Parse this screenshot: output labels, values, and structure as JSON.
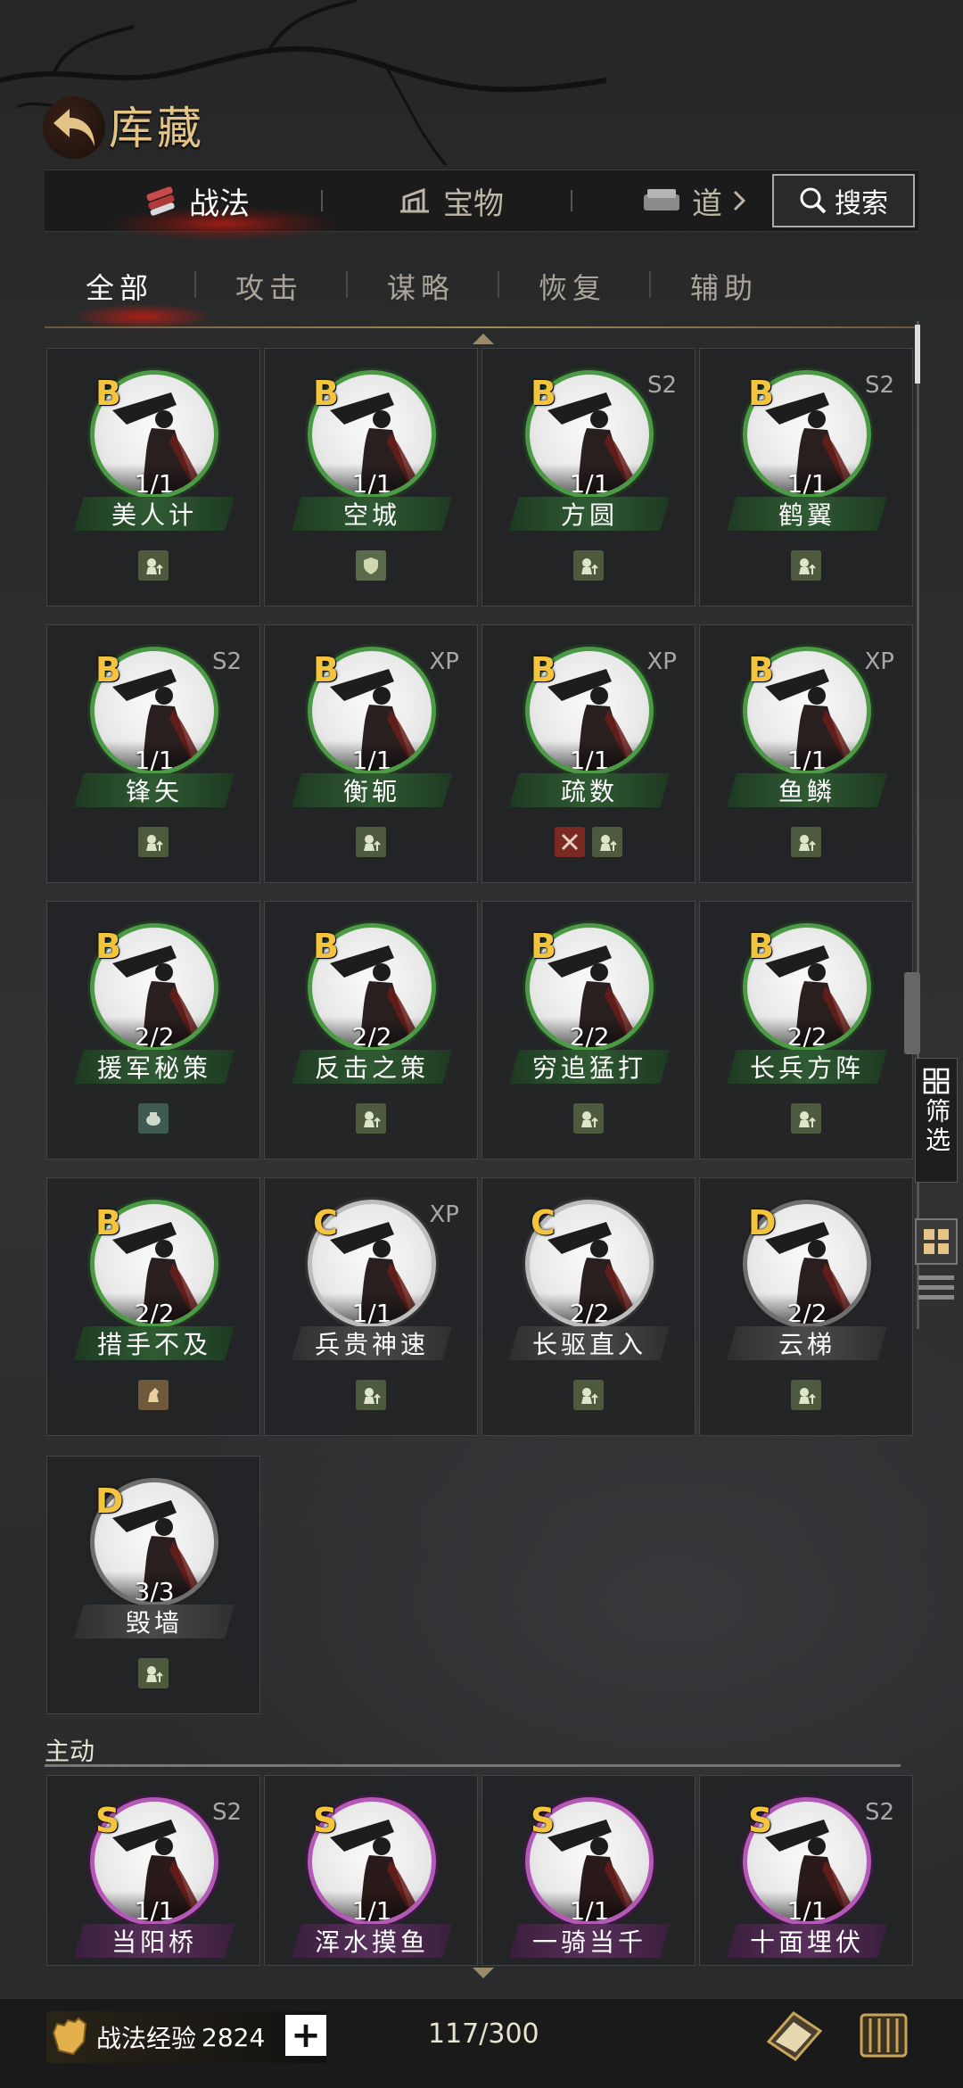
{
  "header": {
    "title": "库藏"
  },
  "top_tabs": {
    "skill": "战法",
    "treasure": "宝物",
    "item": "道",
    "search": "搜索"
  },
  "sub_tabs": [
    "全部",
    "攻击",
    "谋略",
    "恢复",
    "辅助"
  ],
  "cards": [
    {
      "grade": "B",
      "tag": "",
      "count": "1/1",
      "name": "美人计",
      "ring": "B",
      "icons": [
        "troop-icon"
      ]
    },
    {
      "grade": "B",
      "tag": "",
      "count": "1/1",
      "name": "空城",
      "ring": "B",
      "icons": [
        "shield-icon"
      ]
    },
    {
      "grade": "B",
      "tag": "S2",
      "count": "1/1",
      "name": "方圆",
      "ring": "B",
      "icons": [
        "troop-icon"
      ]
    },
    {
      "grade": "B",
      "tag": "S2",
      "count": "1/1",
      "name": "鹤翼",
      "ring": "B",
      "icons": [
        "troop-icon"
      ]
    },
    {
      "grade": "B",
      "tag": "S2",
      "count": "1/1",
      "name": "锋矢",
      "ring": "B",
      "icons": [
        "troop-icon"
      ]
    },
    {
      "grade": "B",
      "tag": "XP",
      "count": "1/1",
      "name": "衡轭",
      "ring": "B",
      "icons": [
        "troop-icon"
      ]
    },
    {
      "grade": "B",
      "tag": "XP",
      "count": "1/1",
      "name": "疏数",
      "ring": "B",
      "icons": [
        "sword-icon",
        "troop-icon"
      ]
    },
    {
      "grade": "B",
      "tag": "XP",
      "count": "1/1",
      "name": "鱼鳞",
      "ring": "B",
      "icons": [
        "troop-icon"
      ]
    },
    {
      "grade": "B",
      "tag": "",
      "count": "2/2",
      "name": "援军秘策",
      "ring": "B",
      "icons": [
        "pot-icon"
      ]
    },
    {
      "grade": "B",
      "tag": "",
      "count": "2/2",
      "name": "反击之策",
      "ring": "B",
      "icons": [
        "troop-icon"
      ]
    },
    {
      "grade": "B",
      "tag": "",
      "count": "2/2",
      "name": "穷追猛打",
      "ring": "B",
      "icons": [
        "troop-icon"
      ]
    },
    {
      "grade": "B",
      "tag": "",
      "count": "2/2",
      "name": "长兵方阵",
      "ring": "B",
      "icons": [
        "troop-icon"
      ]
    },
    {
      "grade": "B",
      "tag": "",
      "count": "2/2",
      "name": "措手不及",
      "ring": "B",
      "icons": [
        "horse-icon"
      ]
    },
    {
      "grade": "C",
      "tag": "XP",
      "count": "1/1",
      "name": "兵贵神速",
      "ring": "C",
      "icons": [
        "troop-icon"
      ]
    },
    {
      "grade": "C",
      "tag": "",
      "count": "2/2",
      "name": "长驱直入",
      "ring": "C",
      "icons": [
        "troop-icon"
      ]
    },
    {
      "grade": "D",
      "tag": "",
      "count": "2/2",
      "name": "云梯",
      "ring": "D",
      "icons": [
        "troop-icon"
      ]
    },
    {
      "grade": "D",
      "tag": "",
      "count": "3/3",
      "name": "毁墙",
      "ring": "D",
      "icons": [
        "troop-icon"
      ]
    }
  ],
  "section": {
    "label": "主动"
  },
  "active_cards": [
    {
      "grade": "S",
      "tag": "S2",
      "count": "1/1",
      "name": "当阳桥",
      "ring": "S"
    },
    {
      "grade": "S",
      "tag": "",
      "count": "1/1",
      "name": "浑水摸鱼",
      "ring": "S"
    },
    {
      "grade": "S",
      "tag": "",
      "count": "1/1",
      "name": "一骑当千",
      "ring": "S"
    },
    {
      "grade": "S",
      "tag": "S2",
      "count": "1/1",
      "name": "十面埋伏",
      "ring": "S"
    }
  ],
  "side": {
    "filter_label": "筛选"
  },
  "bottom": {
    "exp_label": "战法经验",
    "exp_value": "2824",
    "plus": "+",
    "capacity": "117/300"
  },
  "colors": {
    "grade_gold": "#f3c43c",
    "ring_green": "#4c9a46",
    "ring_purple": "#b45ab6",
    "title_gold": "#e3c486"
  }
}
